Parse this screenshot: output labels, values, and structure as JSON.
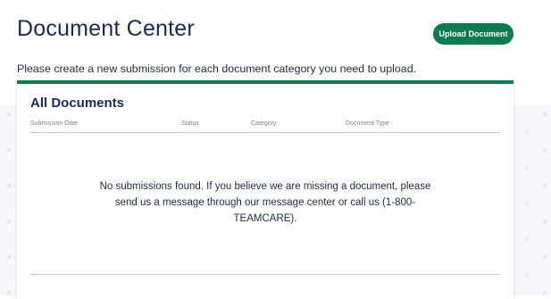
{
  "header": {
    "title": "Document Center",
    "upload_button_label": "Upload Document",
    "instruction": "Please create a new submission for each document category you need to upload."
  },
  "card": {
    "title": "All Documents",
    "columns": [
      "Submission Date",
      "Status",
      "Category",
      "Document Type"
    ],
    "empty_message": "No submissions found. If you believe we are missing a document, please send us a message through our message center or call us (1-800-TEAMCARE)."
  },
  "colors": {
    "accent_green": "#0d7a4f",
    "text_navy": "#1c2b4b",
    "muted_text": "#7a7f8a"
  }
}
